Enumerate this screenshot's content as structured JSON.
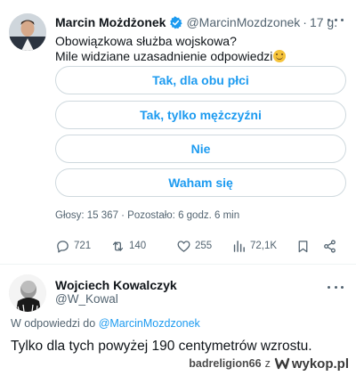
{
  "tweet": {
    "author_name": "Marcin Możdżonek",
    "handle": "@MarcinMozdzonek",
    "dot": "·",
    "time": "17 g.",
    "text_line1": "Obowiązkowa służba wojskowa?",
    "text_line2": "Mile widziane uzasadnienie odpowiedzi",
    "poll": {
      "options": [
        "Tak, dla obu płci",
        "Tak, tylko mężczyźni",
        "Nie",
        "Waham się"
      ],
      "meta": "Głosy: 15 367 · Pozostało: 6 godz. 6 min"
    },
    "actions": {
      "replies": "721",
      "retweets": "140",
      "likes": "255",
      "views": "72,1K"
    },
    "accent": "#1d9bf0"
  },
  "reply": {
    "author_name": "Wojciech Kowalczyk",
    "handle": "@W_Kowal",
    "reply_to_prefix": "W odpowiedzi do",
    "reply_to_mention": "@MarcinMozdzonek",
    "text": "Tylko dla tych powyżej 190 centymetrów wzrostu."
  },
  "watermark": {
    "user": "badreligion66",
    "z": "z",
    "site": "wykop.pl"
  }
}
